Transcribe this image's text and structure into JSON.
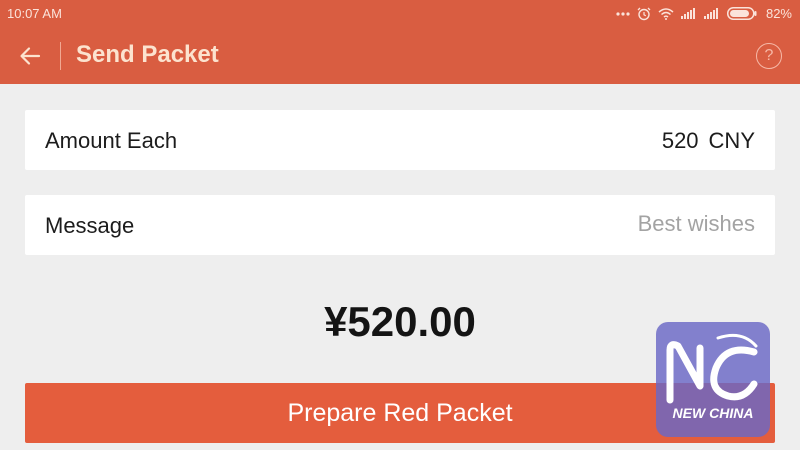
{
  "status_bar": {
    "time": "10:07  AM",
    "battery_percent": "82%"
  },
  "nav": {
    "title": "Send Packet",
    "back_icon": "arrow-left-icon",
    "help_icon": "question-circle-icon",
    "help_glyph": "?"
  },
  "amount_row": {
    "label": "Amount Each",
    "value": "520",
    "currency": "CNY"
  },
  "message_row": {
    "label": "Message",
    "placeholder": "Best wishes",
    "value": ""
  },
  "total": "¥520.00",
  "prepare_button": "Prepare Red Packet",
  "watermark": {
    "logo_text": "NEW CHINA"
  },
  "colors": {
    "header": "#d95d41",
    "button": "#e45d3d",
    "background": "#eeeeee"
  }
}
